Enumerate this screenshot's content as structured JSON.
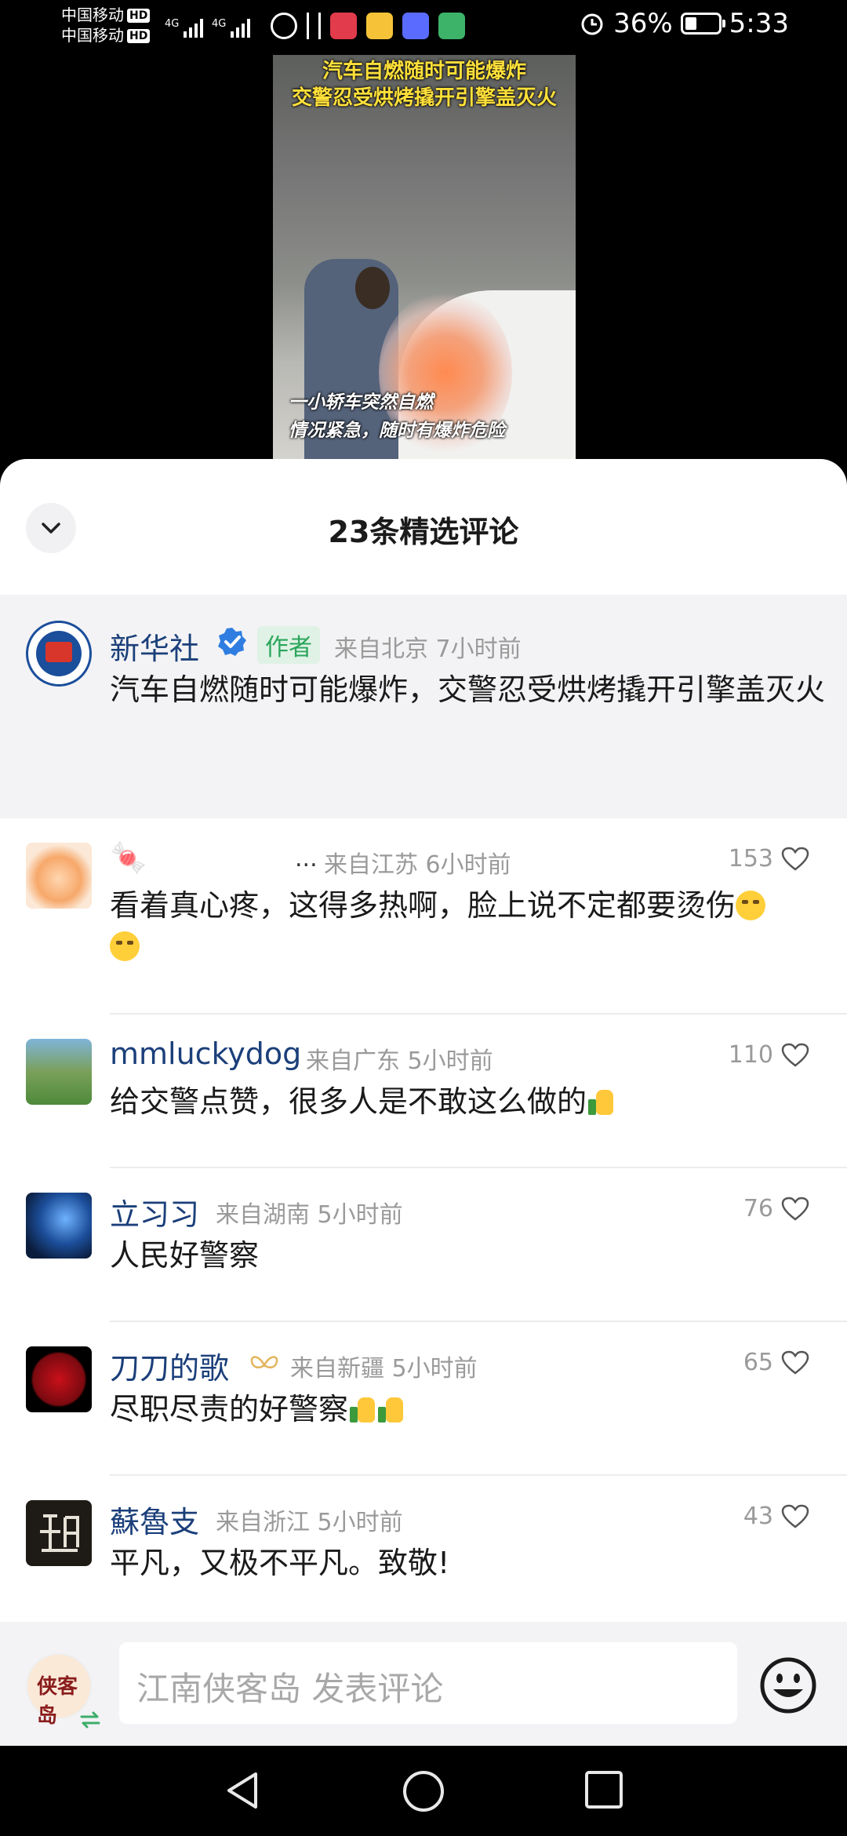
{
  "status": {
    "carrier1": "中国移动",
    "carrier2": "中国移动",
    "hd": "HD",
    "net1": "4G",
    "net2": "4G",
    "battery": "36%",
    "time": "5:33",
    "battery_fraction": 0.36
  },
  "video": {
    "title_line1": "汽车自燃随时可能爆炸",
    "title_line2": "交警忍受烘烤撬开引擎盖灭火",
    "subtitle_line1": "一小轿车突然自燃",
    "subtitle_line2": "情况紧急，随时有爆炸危险"
  },
  "sheet": {
    "title": "23条精选评论"
  },
  "author_comment": {
    "name": "新华社",
    "role_badge": "作者",
    "meta": "来自北京 7小时前",
    "text": "汽车自燃随时可能爆炸，交警忍受烘烤撬开引擎盖灭火"
  },
  "comments": [
    {
      "name": "🍬",
      "ellipsis": "...",
      "meta": "来自江苏 6小时前",
      "likes": "153",
      "text": "看着真心疼，这得多热啊，脸上说不定都要烫伤",
      "emoji_count": 2,
      "emoji_type": "cry"
    },
    {
      "name": "mmluckydog",
      "meta": "来自广东 5小时前",
      "likes": "110",
      "text": "给交警点赞，很多人是不敢这么做的",
      "emoji_count": 1,
      "emoji_type": "thumb"
    },
    {
      "name": "立习习",
      "meta": "来自湖南 5小时前",
      "likes": "76",
      "text": "人民好警察",
      "emoji_count": 0
    },
    {
      "name": "刀刀的歌",
      "meta": "来自新疆 5小时前",
      "likes": "65",
      "text": "尽职尽责的好警察",
      "emoji_count": 2,
      "emoji_type": "thumb"
    },
    {
      "name": "蘇魯支",
      "meta": "来自浙江 5小时前",
      "likes": "43",
      "text": "平凡，又极不平凡。致敬!",
      "emoji_count": 0
    }
  ],
  "composer": {
    "avatar_text": "侠客岛",
    "placeholder": "江南侠客岛 发表评论"
  },
  "icons": {
    "collapse": "chevron-down-icon",
    "verified": "verified-badge-icon",
    "like": "heart-outline-icon",
    "emoji": "smiley-icon",
    "back": "nav-back-icon",
    "home": "nav-home-icon",
    "recents": "nav-recents-icon"
  }
}
